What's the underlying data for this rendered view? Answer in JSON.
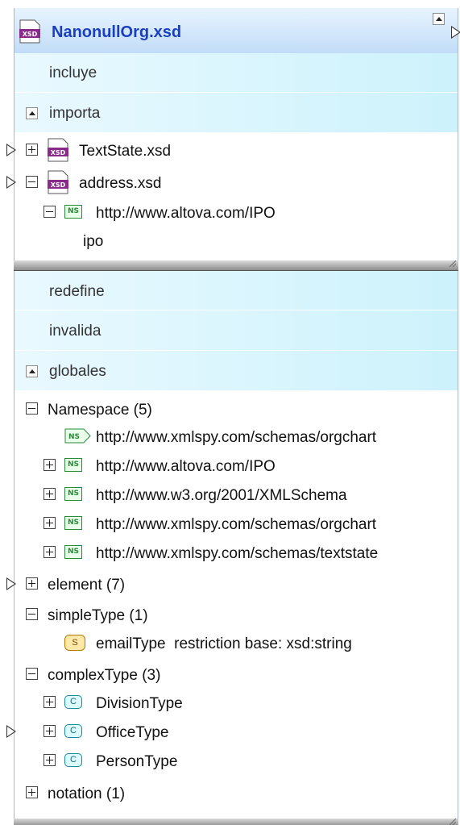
{
  "file": {
    "name": "NanonullOrg.xsd",
    "icon": "xsd-file-icon"
  },
  "sections": {
    "includes": "incluye",
    "imports": "importa",
    "redefines": "redefine",
    "overrides": "invalida",
    "globals": "globales"
  },
  "imports": [
    {
      "name": "TextState.xsd",
      "expanded": false
    },
    {
      "name": "address.xsd",
      "expanded": true,
      "namespace": "http://www.altova.com/IPO",
      "prefix": "ipo"
    }
  ],
  "namespaces": {
    "label": "Namespace (5)",
    "items": [
      "http://www.xmlspy.com/schemas/orgchart",
      "http://www.altova.com/IPO",
      "http://www.w3.org/2001/XMLSchema",
      "http://www.xmlspy.com/schemas/orgchart",
      "http://www.xmlspy.com/schemas/textstate"
    ]
  },
  "element": {
    "label": "element (7)"
  },
  "simpleType": {
    "label": "simpleType (1)",
    "item": "emailType  restriction base: xsd:string"
  },
  "complexType": {
    "label": "complexType (3)",
    "items": [
      "DivisionType",
      "OfficeType",
      "PersonType"
    ]
  },
  "notation": {
    "label": "notation (1)"
  },
  "icons": {
    "ns": "NS",
    "complex": "C",
    "simple": "S"
  },
  "colors": {
    "header_start": "#e8f4ff",
    "header_end": "#bcd9f6",
    "band": "#cdf2fc",
    "title": "#1a3fbf"
  }
}
